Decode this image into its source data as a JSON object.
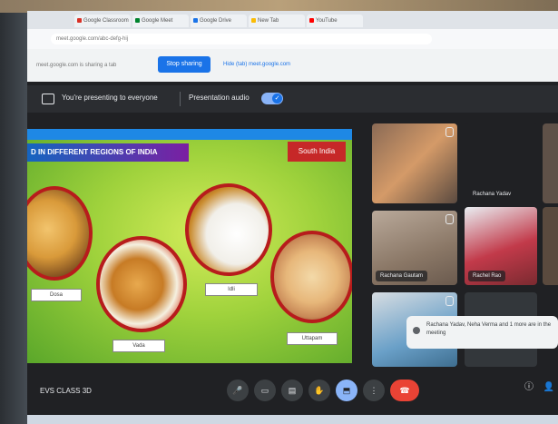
{
  "browser": {
    "tabs": [
      {
        "label": "Google Classroom",
        "color": "#d93025"
      },
      {
        "label": "Google Meet",
        "color": "#00832d"
      },
      {
        "label": "Google Drive",
        "color": "#1a73e8"
      },
      {
        "label": "New Tab",
        "color": "#fbbc04"
      },
      {
        "label": "YouTube",
        "color": "#ff0000"
      }
    ],
    "url": "meet.google.com/abc-defg-hij"
  },
  "share_bar": {
    "info_text": "meet.google.com is sharing a tab",
    "stop_label": "Stop sharing",
    "hide_label": "Hide",
    "hide_label_full": "Hide (tab) meet.google.com"
  },
  "banner": {
    "presenting_text": "You're presenting to everyone",
    "audio_label": "Presentation audio",
    "toggle_symbol": "✓"
  },
  "slide": {
    "title": "D IN DIFFERENT REGIONS OF INDIA",
    "region": "South India",
    "labels": [
      "Dosa",
      "Vada",
      "Idli",
      "Uttapam"
    ]
  },
  "participants": [
    {
      "name": ""
    },
    {
      "name": "Rachana Yadav"
    },
    {
      "name": ""
    },
    {
      "name": "Rachana Gautam"
    },
    {
      "name": "Rachel Rao"
    },
    {
      "name": ""
    },
    {
      "name": ""
    },
    {
      "name": ""
    }
  ],
  "toast": {
    "text": "Rachana Yadav, Neha Verma and 1 more are in the meeting"
  },
  "meeting": {
    "name": "EVS CLASS 3D"
  },
  "controls": {
    "mic_icon": "🎤",
    "camera_icon": "▭",
    "captions_icon": "▤",
    "raise_hand_icon": "✋",
    "present_icon": "⬒",
    "more_icon": "⋮",
    "end_icon": "☎",
    "info_icon": "ⓘ",
    "people_icon": "👤"
  },
  "colors": {
    "meet_bg": "#202124",
    "accent_blue": "#8ab4f8",
    "end_call_red": "#ea4335",
    "slide_green": "#9fd23c"
  }
}
